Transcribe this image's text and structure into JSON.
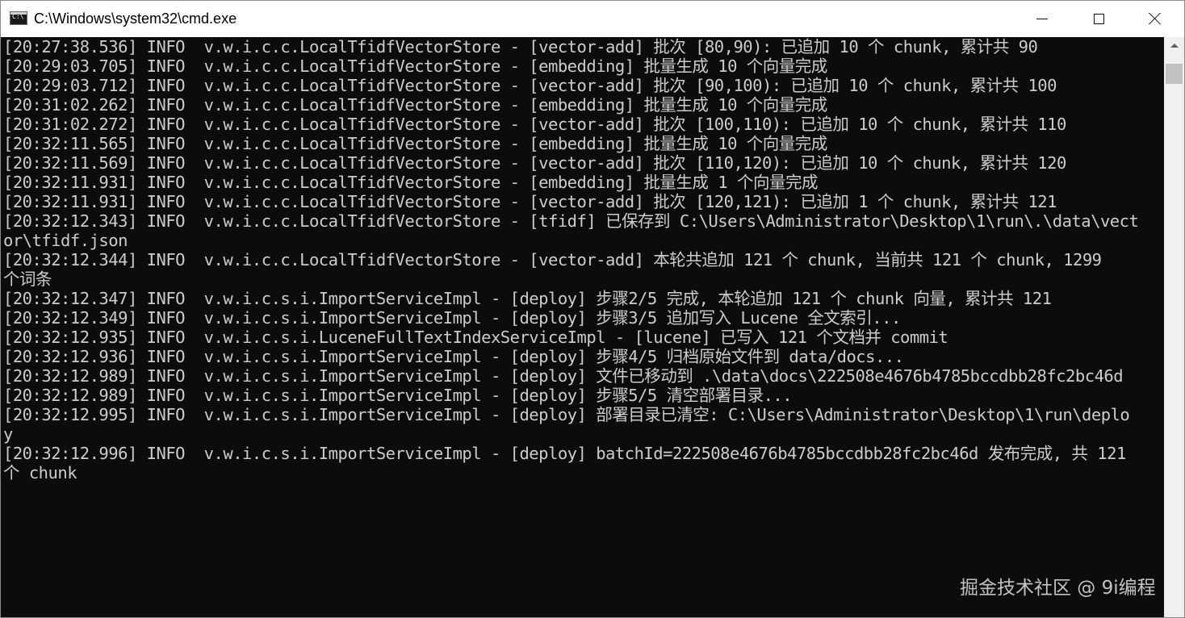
{
  "window": {
    "title": "C:\\Windows\\system32\\cmd.exe",
    "icon": "cmd-icon",
    "icon_text": "C:\\",
    "controls": {
      "minimize": "minimize-icon",
      "maximize": "maximize-icon",
      "close": "close-icon"
    }
  },
  "console": {
    "background": "#0c0c0c",
    "foreground": "#cccccc",
    "lines": [
      "[20:27:38.536] INFO  v.w.i.c.c.LocalTfidfVectorStore - [vector-add] 批次 [80,90): 已追加 10 个 chunk, 累计共 90",
      "[20:29:03.705] INFO  v.w.i.c.c.LocalTfidfVectorStore - [embedding] 批量生成 10 个向量完成",
      "[20:29:03.712] INFO  v.w.i.c.c.LocalTfidfVectorStore - [vector-add] 批次 [90,100): 已追加 10 个 chunk, 累计共 100",
      "[20:31:02.262] INFO  v.w.i.c.c.LocalTfidfVectorStore - [embedding] 批量生成 10 个向量完成",
      "[20:31:02.272] INFO  v.w.i.c.c.LocalTfidfVectorStore - [vector-add] 批次 [100,110): 已追加 10 个 chunk, 累计共 110",
      "[20:32:11.565] INFO  v.w.i.c.c.LocalTfidfVectorStore - [embedding] 批量生成 10 个向量完成",
      "[20:32:11.569] INFO  v.w.i.c.c.LocalTfidfVectorStore - [vector-add] 批次 [110,120): 已追加 10 个 chunk, 累计共 120",
      "[20:32:11.931] INFO  v.w.i.c.c.LocalTfidfVectorStore - [embedding] 批量生成 1 个向量完成",
      "[20:32:11.931] INFO  v.w.i.c.c.LocalTfidfVectorStore - [vector-add] 批次 [120,121): 已追加 1 个 chunk, 累计共 121",
      "[20:32:12.343] INFO  v.w.i.c.c.LocalTfidfVectorStore - [tfidf] 已保存到 C:\\Users\\Administrator\\Desktop\\1\\run\\.\\data\\vect",
      "or\\tfidf.json",
      "[20:32:12.344] INFO  v.w.i.c.c.LocalTfidfVectorStore - [vector-add] 本轮共追加 121 个 chunk, 当前共 121 个 chunk, 1299",
      "个词条",
      "[20:32:12.347] INFO  v.w.i.c.s.i.ImportServiceImpl - [deploy] 步骤2/5 完成, 本轮追加 121 个 chunk 向量, 累计共 121",
      "[20:32:12.349] INFO  v.w.i.c.s.i.ImportServiceImpl - [deploy] 步骤3/5 追加写入 Lucene 全文索引...",
      "[20:32:12.935] INFO  v.w.i.c.s.i.LuceneFullTextIndexServiceImpl - [lucene] 已写入 121 个文档并 commit",
      "[20:32:12.936] INFO  v.w.i.c.s.i.ImportServiceImpl - [deploy] 步骤4/5 归档原始文件到 data/docs...",
      "[20:32:12.989] INFO  v.w.i.c.s.i.ImportServiceImpl - [deploy] 文件已移动到 .\\data\\docs\\222508e4676b4785bccdbb28fc2bc46d",
      "[20:32:12.989] INFO  v.w.i.c.s.i.ImportServiceImpl - [deploy] 步骤5/5 清空部署目录...",
      "[20:32:12.995] INFO  v.w.i.c.s.i.ImportServiceImpl - [deploy] 部署目录已清空: C:\\Users\\Administrator\\Desktop\\1\\run\\deplo",
      "y",
      "[20:32:12.996] INFO  v.w.i.c.s.i.ImportServiceImpl - [deploy] batchId=222508e4676b4785bccdbb28fc2bc46d 发布完成, 共 121",
      "个 chunk"
    ]
  },
  "scrollbar": {
    "up_arrow": "scroll-up-arrow-icon"
  },
  "watermark": "掘金技术社区 @ 9i编程"
}
